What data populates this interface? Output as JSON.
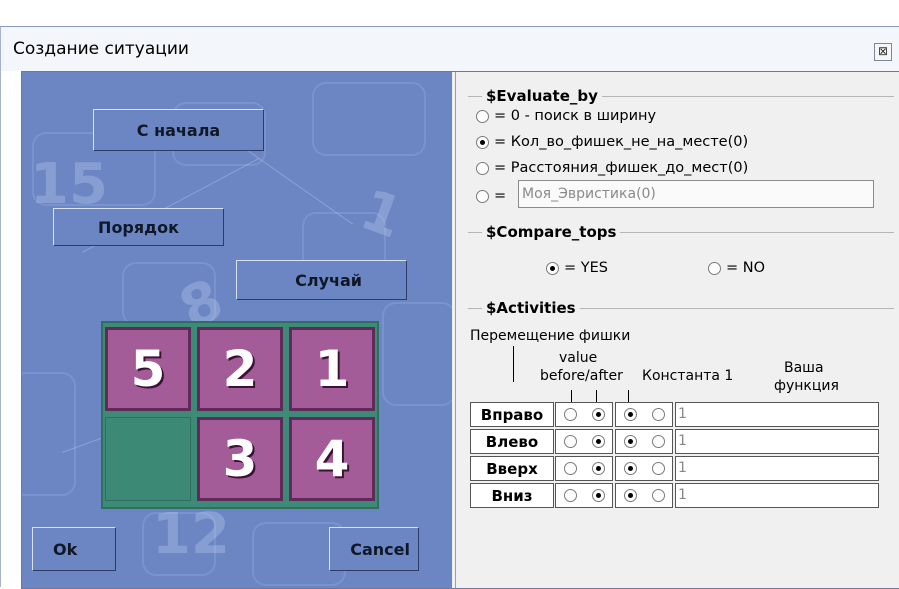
{
  "window": {
    "title": "Создание ситуации",
    "close_label": "⊠"
  },
  "left": {
    "buttons": {
      "restart": "С начала",
      "order": "Порядок",
      "random": "Случай",
      "ok": "Ok",
      "cancel": "Cancel"
    },
    "board": {
      "tiles": [
        "5",
        "2",
        "1",
        "",
        "3",
        "4"
      ]
    }
  },
  "evaluate": {
    "title": "$Evaluate_by",
    "options": [
      {
        "label": "= 0 - поиск в ширину",
        "selected": false
      },
      {
        "label": "= Кол_во_фишек_не_на_месте(0)",
        "selected": true
      },
      {
        "label": "= Расстояния_фишек_до_мест(0)",
        "selected": false
      },
      {
        "label": "=",
        "selected": false
      }
    ],
    "custom_value": "Моя_Эвристика(0)"
  },
  "compare": {
    "title": "$Compare_tops",
    "yes_label": "= YES",
    "no_label": "= NO",
    "selected": "yes"
  },
  "activities": {
    "title": "$Activities",
    "header_move": "Перемещение фишки",
    "header_value": "value",
    "header_before_after": "before/after",
    "header_const": "Константа 1",
    "header_func_1": "Ваша",
    "header_func_2": "функция",
    "rows": [
      {
        "label": "Вправо",
        "before_after": "after",
        "const": "left",
        "value": "1"
      },
      {
        "label": "Влево",
        "before_after": "after",
        "const": "left",
        "value": "1"
      },
      {
        "label": "Вверх",
        "before_after": "after",
        "const": "left",
        "value": "1"
      },
      {
        "label": "Вниз",
        "before_after": "after",
        "const": "left",
        "value": "1"
      }
    ]
  }
}
